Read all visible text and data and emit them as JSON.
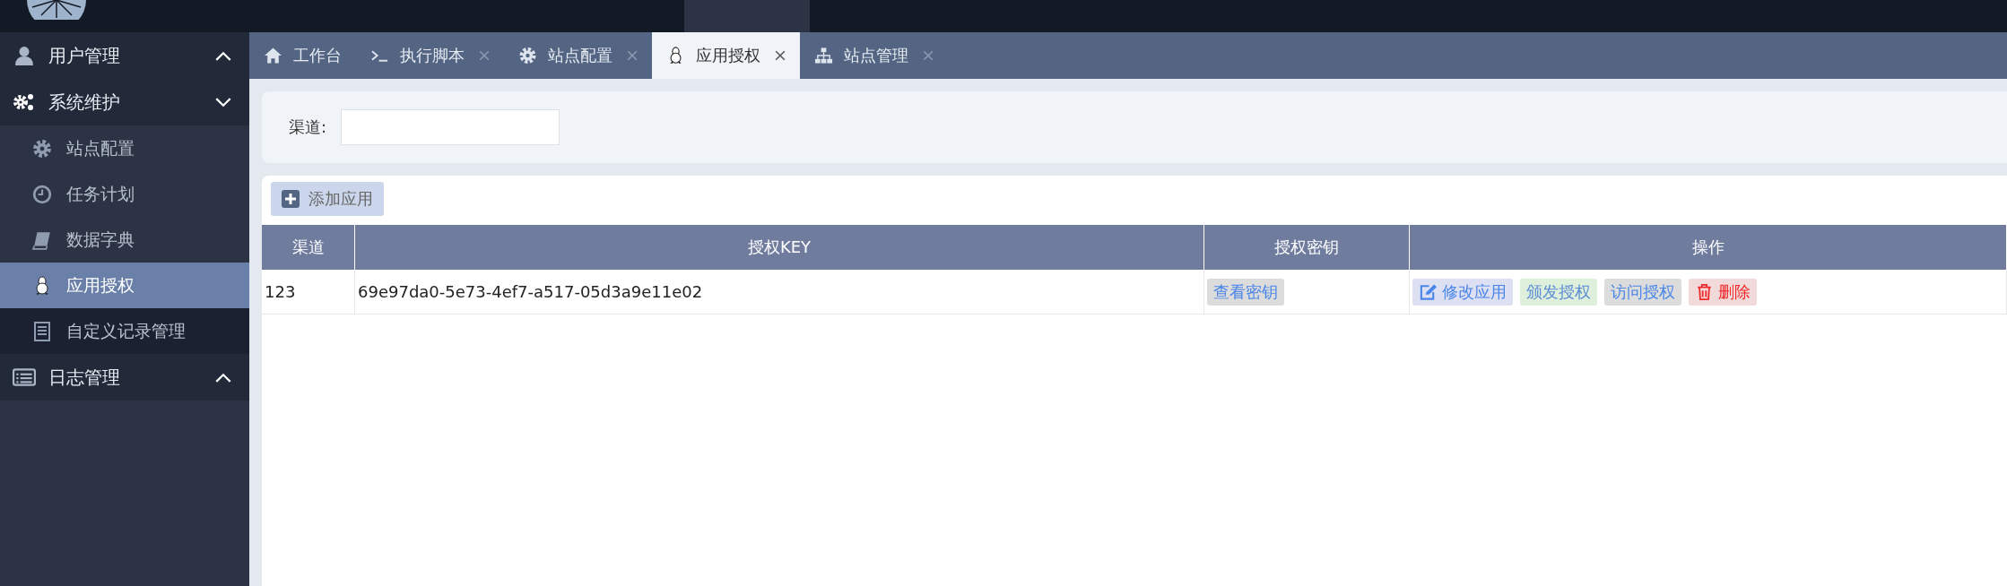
{
  "sidebar": {
    "groups": [
      {
        "label": "用户管理",
        "expanded": false
      },
      {
        "label": "系统维护",
        "expanded": true,
        "children": [
          {
            "label": "站点配置",
            "selected": false,
            "hovered": false
          },
          {
            "label": "任务计划",
            "selected": false,
            "hovered": false
          },
          {
            "label": "数据字典",
            "selected": false,
            "hovered": false
          },
          {
            "label": "应用授权",
            "selected": true,
            "hovered": false
          },
          {
            "label": "自定义记录管理",
            "selected": false,
            "hovered": true
          }
        ]
      },
      {
        "label": "日志管理",
        "expanded": false
      }
    ]
  },
  "tabs": [
    {
      "label": "工作台",
      "closable": false,
      "selected": false
    },
    {
      "label": "执行脚本",
      "closable": true,
      "selected": false
    },
    {
      "label": "站点配置",
      "closable": true,
      "selected": false
    },
    {
      "label": "应用授权",
      "closable": true,
      "selected": true
    },
    {
      "label": "站点管理",
      "closable": true,
      "selected": false
    }
  ],
  "filter": {
    "label": "渠道:"
  },
  "add_button": "添加应用",
  "table": {
    "columns": [
      "渠道",
      "授权KEY",
      "授权密钥",
      "操作"
    ],
    "rows": [
      {
        "channel": "123",
        "key": "69e97da0-5e73-4ef7-a517-05d3a9e11e02",
        "secret_button": "查看密钥",
        "actions": [
          {
            "label": "修改应用",
            "kind": "edit"
          },
          {
            "label": "颁发授权",
            "kind": "issue"
          },
          {
            "label": "访问授权",
            "kind": "access"
          },
          {
            "label": "删除",
            "kind": "delete"
          }
        ]
      }
    ]
  }
}
